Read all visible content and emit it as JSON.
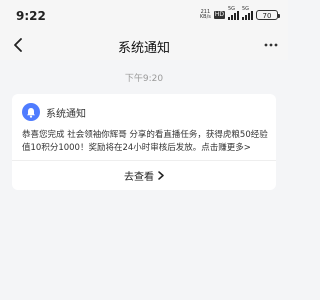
{
  "status_bar": {
    "time": "9:22",
    "net_speed_value": "211",
    "net_speed_unit": "KB/s",
    "hd_label": "HD",
    "signal_label_1": "5G",
    "signal_label_2": "5G",
    "battery": "70"
  },
  "nav": {
    "title": "系统通知"
  },
  "message": {
    "timestamp": "下午9:20",
    "title": "系统通知",
    "body": "恭喜您完成 社会领袖你辉哥 分享的看直播任务，获得虎粮50经验值10积分1000！奖励将在24小时审核后发放。点击赚更多>",
    "action_label": "去查看"
  },
  "colors": {
    "accent": "#4f7cff",
    "background": "#f4f5f7"
  },
  "icons": {
    "back": "back-arrow-icon",
    "more": "more-dots-icon",
    "bell": "bell-icon",
    "chevron": "chevron-right-icon"
  }
}
